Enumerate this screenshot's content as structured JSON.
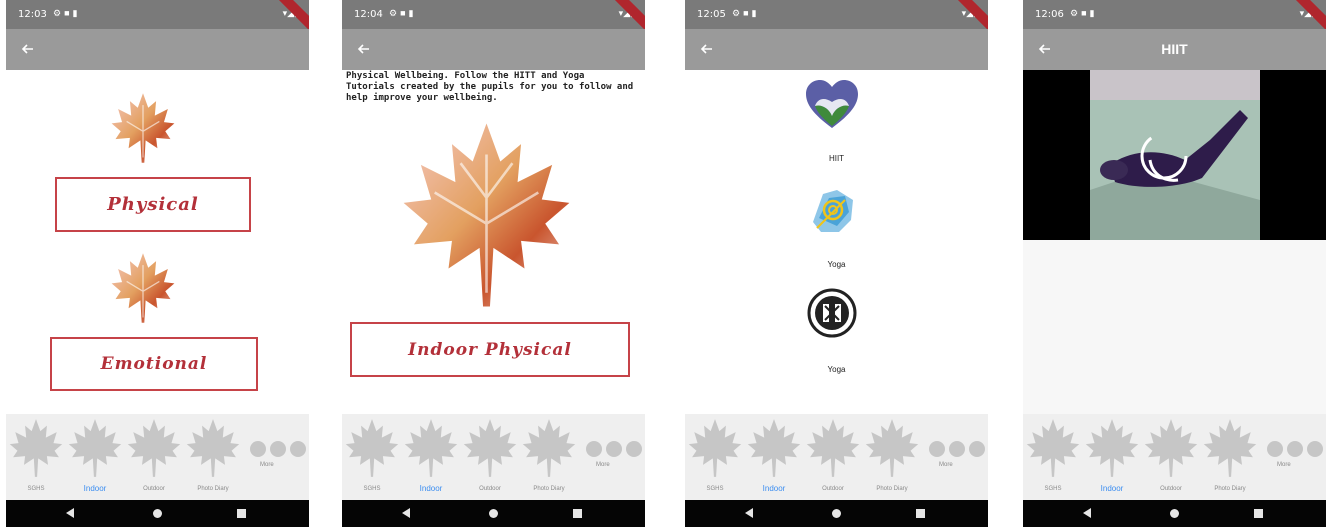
{
  "colors": {
    "statusbar": "#7a7a7a",
    "appbar": "#9a9a9a",
    "button_border": "#c64348",
    "button_text": "#b33039",
    "nav_active": "#3d8ef0",
    "nav_inactive": "#8a8a8a"
  },
  "screens": [
    {
      "status_time": "12:03",
      "title": "",
      "buttons": [
        "Physical",
        "Emotional"
      ]
    },
    {
      "status_time": "12:04",
      "title": "",
      "description": "Physical Wellbeing. Follow the HITT and Yoga Tutorials created by the pupils for you to follow and help improve your wellbeing.",
      "buttons": [
        "Indoor Physical"
      ]
    },
    {
      "status_time": "12:05",
      "title": "",
      "items": [
        "HIIT",
        "Yoga",
        "Yoga"
      ]
    },
    {
      "status_time": "12:06",
      "title": "HIIT"
    }
  ],
  "nav": {
    "items": [
      "SGHS",
      "Indoor",
      "Outdoor",
      "Photo Diary"
    ],
    "more": "More",
    "active": "Indoor"
  }
}
